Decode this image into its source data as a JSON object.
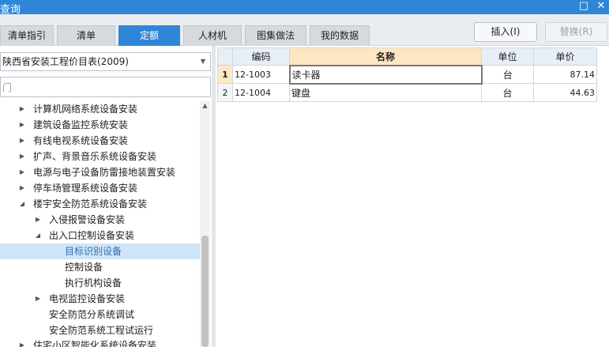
{
  "window": {
    "title": "查询",
    "maximize_glyph": "□",
    "close_glyph": "✕"
  },
  "tabs": [
    {
      "label": "清单指引"
    },
    {
      "label": "清单"
    },
    {
      "label": "定额"
    },
    {
      "label": "人材机"
    },
    {
      "label": "图集做法"
    },
    {
      "label": "我的数据"
    }
  ],
  "active_tab": "定额",
  "buttons": {
    "insert": "插入(I)",
    "replace": "替换(R)"
  },
  "library": {
    "selected": "陕西省安装工程价目表(2009)"
  },
  "search": {
    "value": "门"
  },
  "tree": [
    {
      "label": "计算机网络系统设备安装",
      "expanded": false
    },
    {
      "label": "建筑设备监控系统安装",
      "expanded": false
    },
    {
      "label": "有线电视系统设备安装",
      "expanded": false
    },
    {
      "label": "扩声、背景音乐系统设备安装",
      "expanded": false
    },
    {
      "label": "电源与电子设备防雷接地装置安装",
      "expanded": false
    },
    {
      "label": "停车场管理系统设备安装",
      "expanded": false
    },
    {
      "label": "楼宇安全防范系统设备安装",
      "expanded": true
    },
    {
      "label": "入侵报警设备安装",
      "expanded": false
    },
    {
      "label": "出入口控制设备安装",
      "expanded": true
    },
    {
      "label": "目标识别设备",
      "selected": true
    },
    {
      "label": "控制设备"
    },
    {
      "label": "执行机构设备"
    },
    {
      "label": "电视监控设备安装",
      "expanded": false
    },
    {
      "label": "安全防范分系统调试"
    },
    {
      "label": "安全防范系统工程试运行"
    },
    {
      "label": "住宅小区智能化系统设备安装",
      "expanded": false
    }
  ],
  "grid": {
    "columns": {
      "code": "编码",
      "name": "名称",
      "unit": "单位",
      "price": "单价"
    },
    "rows": [
      {
        "num": "1",
        "code": "12-1003",
        "name": "读卡器",
        "unit": "台",
        "price": "87.14"
      },
      {
        "num": "2",
        "code": "12-1004",
        "name": "键盘",
        "unit": "台",
        "price": "44.63"
      }
    ]
  },
  "colors": {
    "accent": "#2f86d6",
    "selection": "#cfe4f7",
    "sorted_header": "#fde7c2"
  },
  "icons": {
    "collapsed": "▶",
    "expanded": "◢",
    "dropdown": "▼",
    "scroll_up": "▲"
  }
}
